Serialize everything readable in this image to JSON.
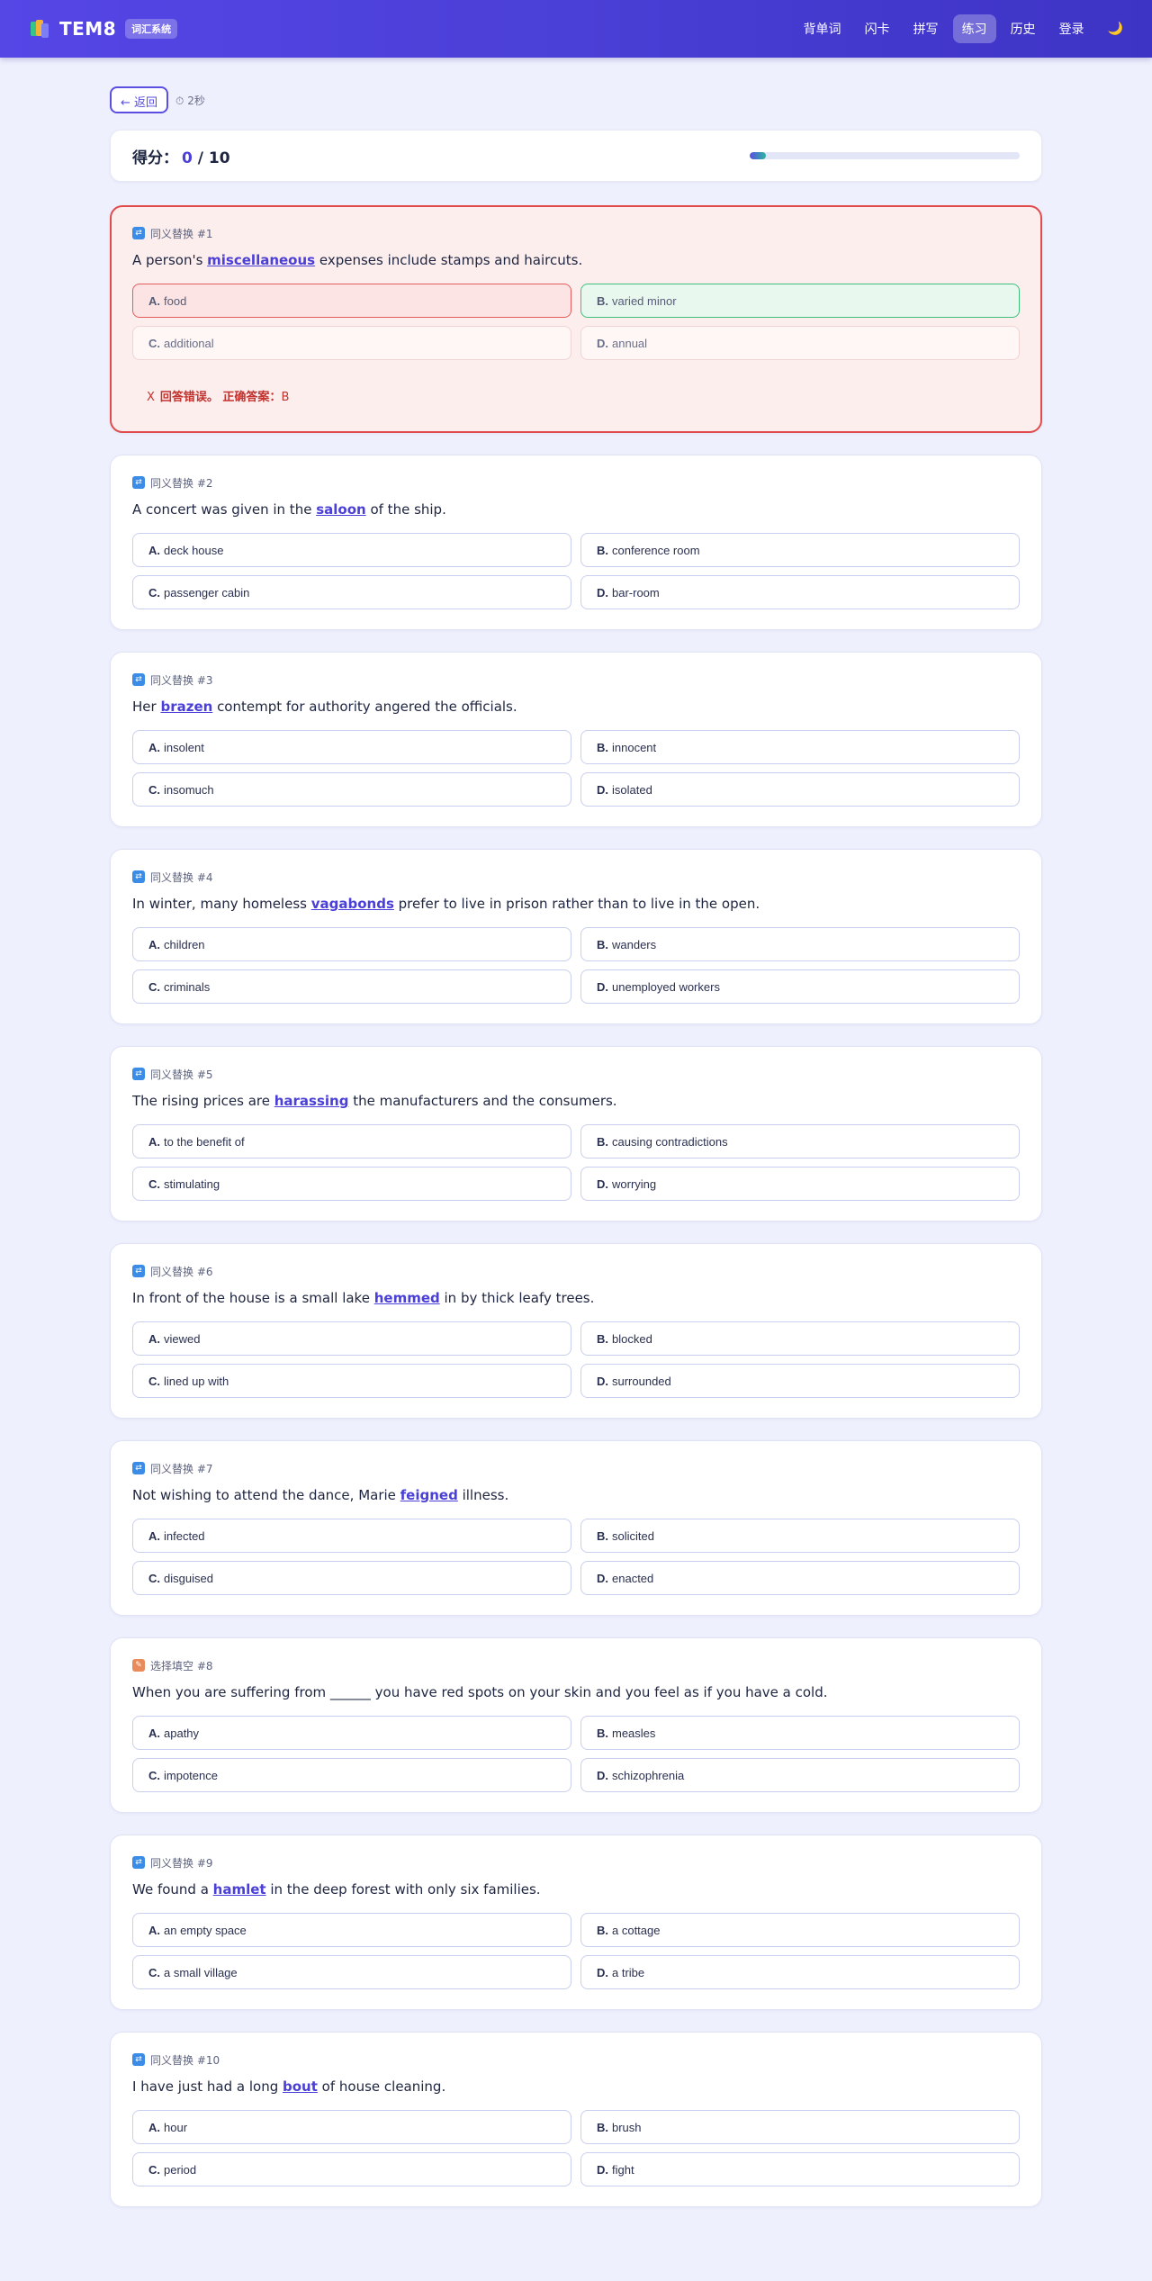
{
  "navbar": {
    "brand": "TEM8",
    "badge": "词汇系统",
    "links": [
      "背单词",
      "闪卡",
      "拼写",
      "练习",
      "历史",
      "登录"
    ],
    "active_link": "练习",
    "theme_icon": "🌙"
  },
  "topbar": {
    "back_label": "← 返回",
    "timer": "⏱ 2秒"
  },
  "score": {
    "label": "得分：",
    "current": "0",
    "total": " / 10",
    "progress": 0.06
  },
  "questions": [
    {
      "type": "同义替换 #1",
      "type_icon": "synonym-icon",
      "text_before": "A person's ",
      "keyword": "miscellaneous",
      "text_after": " expenses include stamps and haircuts.",
      "options": [
        {
          "letter": "A.",
          "text": "food"
        },
        {
          "letter": "B.",
          "text": "varied minor"
        },
        {
          "letter": "C.",
          "text": "additional"
        },
        {
          "letter": "D.",
          "text": "annual"
        }
      ],
      "state": "wrong",
      "selected": "A",
      "correct": "B",
      "feedback_mark": "X",
      "feedback_text": "回答错误。 正确答案：",
      "feedback_answer": "B"
    },
    {
      "type": "同义替换 #2",
      "type_icon": "synonym-icon",
      "text_before": "A concert was given in the ",
      "keyword": "saloon",
      "text_after": " of the ship.",
      "options": [
        {
          "letter": "A.",
          "text": "deck house"
        },
        {
          "letter": "B.",
          "text": "conference room"
        },
        {
          "letter": "C.",
          "text": "passenger cabin"
        },
        {
          "letter": "D.",
          "text": "bar-room"
        }
      ]
    },
    {
      "type": "同义替换 #3",
      "type_icon": "synonym-icon",
      "text_before": "Her ",
      "keyword": "brazen",
      "text_after": " contempt for authority angered the officials.",
      "options": [
        {
          "letter": "A.",
          "text": "insolent"
        },
        {
          "letter": "B.",
          "text": "innocent"
        },
        {
          "letter": "C.",
          "text": "insomuch"
        },
        {
          "letter": "D.",
          "text": "isolated"
        }
      ]
    },
    {
      "type": "同义替换 #4",
      "type_icon": "synonym-icon",
      "text_before": "In winter, many homeless ",
      "keyword": "vagabonds",
      "text_after": " prefer to live in prison rather than to live in the open.",
      "options": [
        {
          "letter": "A.",
          "text": "children"
        },
        {
          "letter": "B.",
          "text": "wanders"
        },
        {
          "letter": "C.",
          "text": "criminals"
        },
        {
          "letter": "D.",
          "text": "unemployed workers"
        }
      ]
    },
    {
      "type": "同义替换 #5",
      "type_icon": "synonym-icon",
      "text_before": "The rising prices are ",
      "keyword": "harassing",
      "text_after": " the manufacturers and the consumers.",
      "options": [
        {
          "letter": "A.",
          "text": "to the benefit of"
        },
        {
          "letter": "B.",
          "text": "causing contradictions"
        },
        {
          "letter": "C.",
          "text": "stimulating"
        },
        {
          "letter": "D.",
          "text": "worrying"
        }
      ]
    },
    {
      "type": "同义替换 #6",
      "type_icon": "synonym-icon",
      "text_before": "In front of the house is a small lake ",
      "keyword": "hemmed",
      "text_after": " in by thick leafy trees.",
      "options": [
        {
          "letter": "A.",
          "text": "viewed"
        },
        {
          "letter": "B.",
          "text": "blocked"
        },
        {
          "letter": "C.",
          "text": "lined up with"
        },
        {
          "letter": "D.",
          "text": "surrounded"
        }
      ]
    },
    {
      "type": "同义替换 #7",
      "type_icon": "synonym-icon",
      "text_before": "Not wishing to attend the dance, Marie ",
      "keyword": "feigned",
      "text_after": " illness.",
      "options": [
        {
          "letter": "A.",
          "text": "infected"
        },
        {
          "letter": "B.",
          "text": "solicited"
        },
        {
          "letter": "C.",
          "text": "disguised"
        },
        {
          "letter": "D.",
          "text": "enacted"
        }
      ]
    },
    {
      "type": "选择填空 #8",
      "type_icon": "fill-blank-icon",
      "text_before": "When you are suffering from ______ you have red spots on your skin and you feel as if you have a cold.",
      "keyword": "",
      "text_after": "",
      "options": [
        {
          "letter": "A.",
          "text": "apathy"
        },
        {
          "letter": "B.",
          "text": "measles"
        },
        {
          "letter": "C.",
          "text": "impotence"
        },
        {
          "letter": "D.",
          "text": "schizophrenia"
        }
      ]
    },
    {
      "type": "同义替换 #9",
      "type_icon": "synonym-icon",
      "text_before": "We found a ",
      "keyword": "hamlet",
      "text_after": " in the deep forest with only six families.",
      "options": [
        {
          "letter": "A.",
          "text": "an empty space"
        },
        {
          "letter": "B.",
          "text": "a cottage"
        },
        {
          "letter": "C.",
          "text": "a small village"
        },
        {
          "letter": "D.",
          "text": "a tribe"
        }
      ]
    },
    {
      "type": "同义替换 #10",
      "type_icon": "synonym-icon",
      "text_before": "I have just had a long ",
      "keyword": "bout",
      "text_after": " of house cleaning.",
      "options": [
        {
          "letter": "A.",
          "text": "hour"
        },
        {
          "letter": "B.",
          "text": "brush"
        },
        {
          "letter": "C.",
          "text": "period"
        },
        {
          "letter": "D.",
          "text": "fight"
        }
      ]
    }
  ]
}
